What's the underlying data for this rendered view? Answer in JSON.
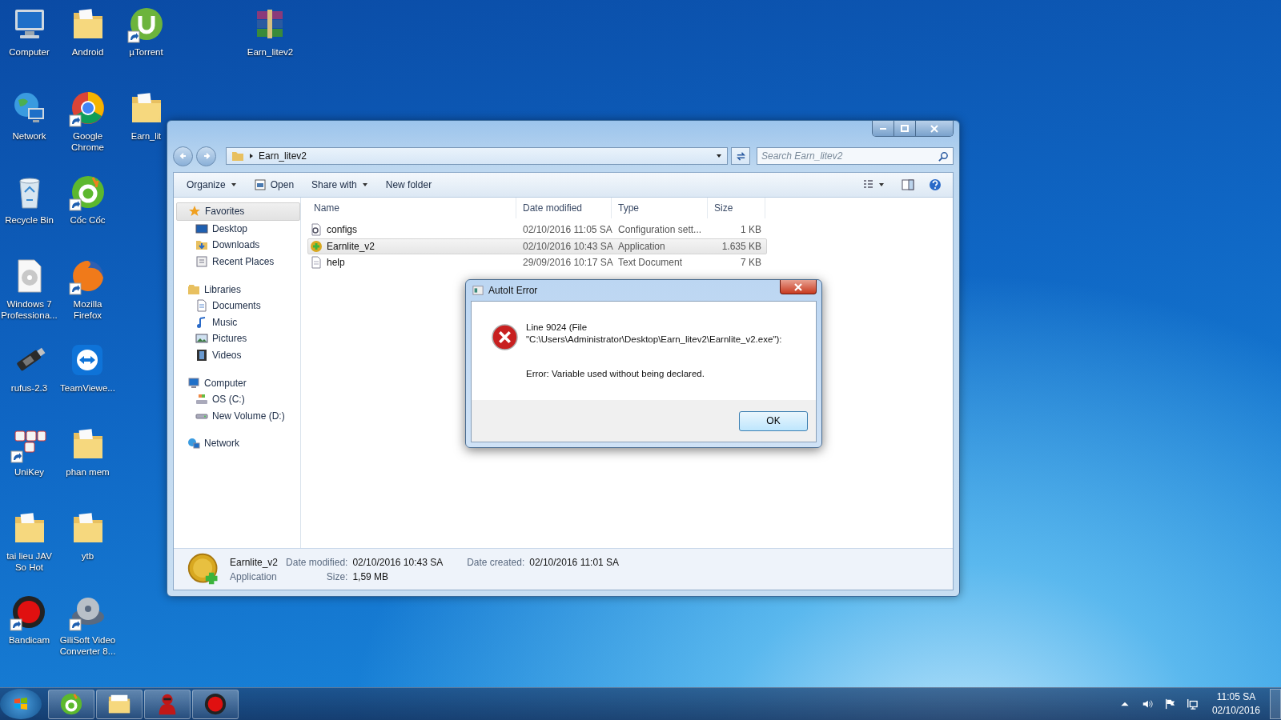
{
  "desktop": {
    "columns": [
      [
        {
          "label": "Computer",
          "kind": "computer",
          "shortcut": false
        },
        {
          "label": "Network",
          "kind": "network",
          "shortcut": false
        },
        {
          "label": "Recycle Bin",
          "kind": "recycle",
          "shortcut": false
        },
        {
          "label": "Windows 7 Professiona...",
          "kind": "disc",
          "shortcut": false
        },
        {
          "label": "rufus-2.3",
          "kind": "usb",
          "shortcut": false
        },
        {
          "label": "UniKey",
          "kind": "unikey",
          "shortcut": true
        },
        {
          "label": "tai lieu JAV So Hot",
          "kind": "folder",
          "shortcut": false
        },
        {
          "label": "Bandicam",
          "kind": "bandicam",
          "shortcut": true
        }
      ],
      [
        {
          "label": "Android",
          "kind": "folder",
          "shortcut": false
        },
        {
          "label": "Google Chrome",
          "kind": "chrome",
          "shortcut": true
        },
        {
          "label": "Cốc Cốc",
          "kind": "coccoc",
          "shortcut": true
        },
        {
          "label": "Mozilla Firefox",
          "kind": "firefox",
          "shortcut": true
        },
        {
          "label": "TeamViewe...",
          "kind": "teamviewer",
          "shortcut": false
        },
        {
          "label": "phan mem",
          "kind": "folder",
          "shortcut": false
        },
        {
          "label": "ytb",
          "kind": "folder",
          "shortcut": false
        },
        {
          "label": "GiliSoft Video Converter 8...",
          "kind": "video",
          "shortcut": true
        }
      ],
      [
        {
          "label": "µTorrent",
          "kind": "torrent",
          "shortcut": true
        },
        {
          "label": "Earn_lit",
          "kind": "folder",
          "shortcut": false
        }
      ],
      [
        {
          "label": "Earn_litev2",
          "kind": "archive",
          "shortcut": false
        }
      ]
    ]
  },
  "explorer": {
    "address": "Earn_litev2",
    "search": {
      "placeholder": "Search Earn_litev2"
    },
    "toolbar": [
      {
        "label": "Organize",
        "kind": "menu"
      },
      {
        "label": "Open",
        "kind": "open"
      },
      {
        "label": "Share with",
        "kind": "menu"
      },
      {
        "label": "New folder",
        "kind": "plain"
      }
    ],
    "sidebar": [
      {
        "label": "Favorites",
        "kind": "star",
        "selected": true,
        "children": [
          {
            "label": "Desktop",
            "kind": "desktop",
            "selected": false
          },
          {
            "label": "Downloads",
            "kind": "downloads",
            "selected": false
          },
          {
            "label": "Recent Places",
            "kind": "recent",
            "selected": false
          }
        ]
      },
      {
        "label": "Libraries",
        "kind": "library",
        "selected": false,
        "children": [
          {
            "label": "Documents",
            "kind": "document",
            "selected": false
          },
          {
            "label": "Music",
            "kind": "music",
            "selected": false
          },
          {
            "label": "Pictures",
            "kind": "pictures",
            "selected": false
          },
          {
            "label": "Videos",
            "kind": "videos",
            "selected": false
          }
        ]
      },
      {
        "label": "Computer",
        "kind": "computer",
        "selected": false,
        "children": [
          {
            "label": "OS (C:)",
            "kind": "drive-os",
            "selected": false
          },
          {
            "label": "New Volume (D:)",
            "kind": "drive",
            "selected": false
          }
        ]
      },
      {
        "label": "Network",
        "kind": "network",
        "selected": false
      }
    ],
    "table": {
      "columns": [
        "Name",
        "Date modified",
        "Type",
        "Size"
      ],
      "rows": [
        {
          "name": "configs",
          "kind": "config",
          "date": "02/10/2016 11:05 SA",
          "type": "Configuration sett...",
          "size": "1 KB",
          "selected": false
        },
        {
          "name": "Earnlite_v2",
          "kind": "app",
          "date": "02/10/2016 10:43 SA",
          "type": "Application",
          "size": "1.635 KB",
          "selected": true
        },
        {
          "name": "help",
          "kind": "text",
          "date": "29/09/2016 10:17 SA",
          "type": "Text Document",
          "size": "7 KB",
          "selected": false
        }
      ]
    },
    "details": {
      "name": "Earnlite_v2",
      "type": "Application",
      "fields": [
        {
          "label": "Date modified:",
          "value": "02/10/2016 10:43 SA"
        },
        {
          "label": "Date created:",
          "value": "02/10/2016 11:01 SA"
        },
        {
          "label": "Size:",
          "value": "1,59 MB"
        }
      ]
    }
  },
  "dialog": {
    "title": "AutoIt Error",
    "lines": [
      "Line 9024  (File",
      "\"C:\\Users\\Administrator\\Desktop\\Earn_litev2\\Earnlite_v2.exe\"):"
    ],
    "error": "Error: Variable used without being declared.",
    "button": "OK"
  },
  "taskbar": {
    "apps": [
      {
        "kind": "coccoc"
      },
      {
        "kind": "explorer"
      },
      {
        "kind": "user"
      },
      {
        "kind": "bandicam"
      }
    ],
    "time": "11:05 SA",
    "date": "02/10/2016"
  }
}
